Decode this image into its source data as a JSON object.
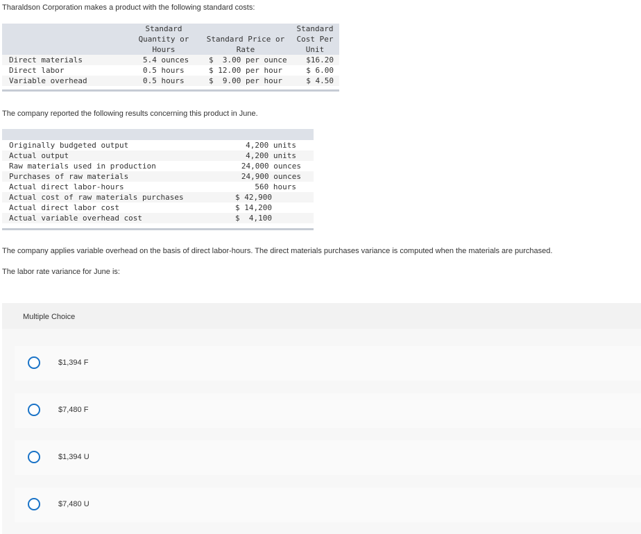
{
  "intro": "Tharaldson Corporation makes a product with the following standard costs:",
  "standard_costs": {
    "headers": {
      "quantity": "Standard\nQuantity or\nHours",
      "price": "Standard Price or\nRate",
      "cost": "Standard\nCost Per\nUnit"
    },
    "rows": [
      {
        "item": "Direct materials",
        "quantity": "5.4 ounces",
        "price": "$  3.00 per ounce",
        "cost": "$16.20"
      },
      {
        "item": "Direct labor",
        "quantity": "0.5 hours",
        "price": "$ 12.00 per hour",
        "cost": "$ 6.00"
      },
      {
        "item": "Variable overhead",
        "quantity": "0.5 hours",
        "price": "$  9.00 per hour",
        "cost": "$ 4.50"
      }
    ]
  },
  "results_intro": "The company reported the following results concerning this product in June.",
  "results": {
    "rows": [
      {
        "label": "Originally budgeted output",
        "value": "4,200 units"
      },
      {
        "label": "Actual output",
        "value": "4,200 units"
      },
      {
        "label": "Raw materials used in production",
        "value": "24,000 ounces"
      },
      {
        "label": "Purchases of raw materials",
        "value": "24,900 ounces"
      },
      {
        "label": "Actual direct labor-hours",
        "value": "560 hours"
      },
      {
        "label": "Actual cost of raw materials purchases",
        "value": "$ 42,900"
      },
      {
        "label": "Actual direct labor cost",
        "value": "$ 14,200"
      },
      {
        "label": "Actual variable overhead cost",
        "value": "$  4,100"
      }
    ]
  },
  "note": "The company applies variable overhead on the basis of direct labor-hours. The direct materials purchases variance is computed when the materials are purchased.",
  "question": "The labor rate variance for June is:",
  "multiple_choice": {
    "title": "Multiple Choice",
    "options": [
      "$1,394 F",
      "$7,480 F",
      "$1,394 U",
      "$7,480 U"
    ]
  }
}
